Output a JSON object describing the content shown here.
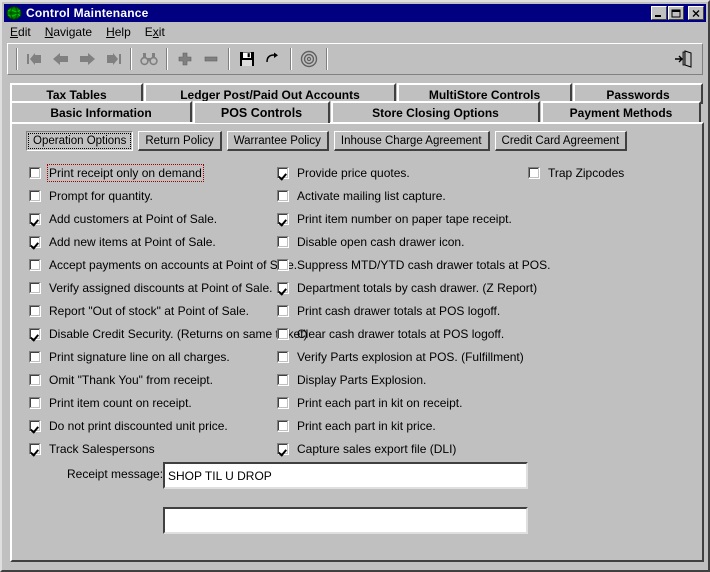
{
  "window": {
    "title": "Control Maintenance",
    "icon": "globe-icon",
    "controls": {
      "minimize": "Minimize",
      "maximize": "Maximize",
      "close": "Close"
    }
  },
  "menubar": {
    "items": [
      {
        "label": "Edit",
        "accel": "E"
      },
      {
        "label": "Navigate",
        "accel": "N"
      },
      {
        "label": "Help",
        "accel": "H"
      },
      {
        "label": "Exit",
        "accel": "x"
      }
    ]
  },
  "toolbar": {
    "buttons": [
      {
        "name": "first-record-icon",
        "tip": "First"
      },
      {
        "name": "previous-record-icon",
        "tip": "Previous"
      },
      {
        "name": "next-record-icon",
        "tip": "Next"
      },
      {
        "name": "last-record-icon",
        "tip": "Last"
      },
      {
        "name": "find-binoculars-icon",
        "tip": "Find"
      },
      {
        "name": "add-plus-icon",
        "tip": "Add"
      },
      {
        "name": "delete-minus-icon",
        "tip": "Delete"
      },
      {
        "name": "save-disk-icon",
        "tip": "Save"
      },
      {
        "name": "refresh-arrow-icon",
        "tip": "Refresh"
      },
      {
        "name": "target-circle-icon",
        "tip": "Process"
      }
    ],
    "exit": {
      "name": "exit-door-icon",
      "tip": "Exit"
    }
  },
  "tabs_row1": [
    {
      "label": "Tax Tables",
      "active": false
    },
    {
      "label": "Ledger Post/Paid Out Accounts",
      "active": false
    },
    {
      "label": "MultiStore Controls",
      "active": false
    },
    {
      "label": "Passwords",
      "active": false
    }
  ],
  "tabs_row2": [
    {
      "label": "Basic Information",
      "active": false
    },
    {
      "label": "POS Controls",
      "active": true
    },
    {
      "label": "Store Closing Options",
      "active": false
    },
    {
      "label": "Payment Methods",
      "active": false
    }
  ],
  "subtabs": [
    {
      "label": "Operation Options",
      "pressed": true
    },
    {
      "label": "Return Policy",
      "pressed": false
    },
    {
      "label": "Warrantee Policy",
      "pressed": false
    },
    {
      "label": "Inhouse Charge Agreement",
      "pressed": false
    },
    {
      "label": "Credit Card Agreement",
      "pressed": false
    }
  ],
  "options_left": [
    {
      "label": "Print receipt only on demand",
      "checked": false,
      "focused": true
    },
    {
      "label": "Prompt for quantity.",
      "checked": false,
      "focused": false
    },
    {
      "label": "Add customers at Point of Sale.",
      "checked": true,
      "focused": false
    },
    {
      "label": "Add new items at Point of Sale.",
      "checked": true,
      "focused": false
    },
    {
      "label": "Accept payments on accounts at Point of Sale.",
      "checked": false,
      "focused": false
    },
    {
      "label": "Verify assigned discounts at Point of Sale.",
      "checked": false,
      "focused": false
    },
    {
      "label": "Report \"Out of stock\" at Point of Sale.",
      "checked": false,
      "focused": false
    },
    {
      "label": "Disable Credit Security. (Returns on same ticket)",
      "checked": true,
      "focused": false
    },
    {
      "label": "Print signature line on all charges.",
      "checked": false,
      "focused": false
    },
    {
      "label": "Omit \"Thank You\" from receipt.",
      "checked": false,
      "focused": false
    },
    {
      "label": "Print item count on receipt.",
      "checked": false,
      "focused": false
    },
    {
      "label": "Do not print discounted unit price.",
      "checked": true,
      "focused": false
    },
    {
      "label": "Track Salespersons",
      "checked": true,
      "focused": false
    }
  ],
  "options_mid": [
    {
      "label": "Provide price quotes.",
      "checked": true
    },
    {
      "label": "Activate mailing list capture.",
      "checked": false
    },
    {
      "label": "Print item number on paper tape receipt.",
      "checked": true
    },
    {
      "label": "Disable open cash drawer icon.",
      "checked": false
    },
    {
      "label": "Suppress MTD/YTD cash drawer totals at POS.",
      "checked": false
    },
    {
      "label": "Department totals by cash drawer. (Z Report)",
      "checked": true
    },
    {
      "label": "Print cash drawer totals at POS logoff.",
      "checked": false
    },
    {
      "label": "Clear cash drawer totals at POS logoff.",
      "checked": false
    },
    {
      "label": "Verify Parts explosion at POS. (Fulfillment)",
      "checked": false
    },
    {
      "label": "Display Parts Explosion.",
      "checked": false
    },
    {
      "label": "Print each part in kit on receipt.",
      "checked": false
    },
    {
      "label": "Print each part in kit price.",
      "checked": false
    },
    {
      "label": "Capture sales export file (DLI)",
      "checked": true
    }
  ],
  "options_right": [
    {
      "label": "Trap Zipcodes",
      "checked": false
    }
  ],
  "receipt": {
    "label": "Receipt message:",
    "line1": "SHOP TIL U DROP",
    "line2": ""
  },
  "colors": {
    "titlebar": "#000080",
    "face": "#c0c0c0",
    "focus_outline": "#a00000"
  }
}
